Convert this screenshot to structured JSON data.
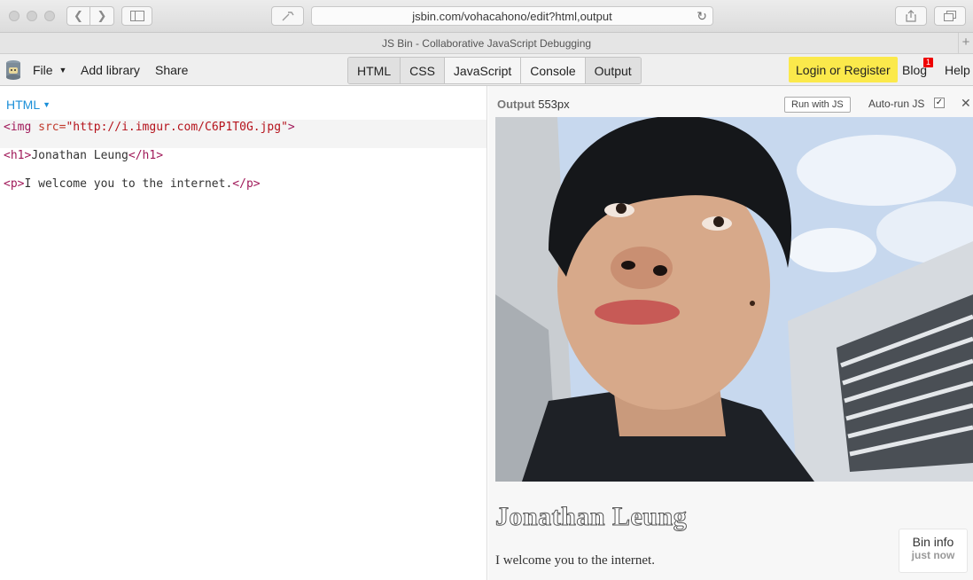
{
  "browser": {
    "url": "jsbin.com/vohacahono/edit?html,output",
    "window_title": "JS Bin - Collaborative JavaScript Debugging"
  },
  "toolbar": {
    "file_label": "File",
    "add_library_label": "Add library",
    "share_label": "Share",
    "panels": [
      "HTML",
      "CSS",
      "JavaScript",
      "Console",
      "Output"
    ],
    "login_label": "Login or Register",
    "blog_label": "Blog",
    "blog_badge": "1",
    "help_label": "Help",
    "accent_color": "#fbe94b"
  },
  "editor": {
    "language_label": "HTML",
    "lines": [
      {
        "open": "<img ",
        "attr": "src=",
        "value": "\"http://i.imgur.com/C6P1T0G.jpg\"",
        "close": ">"
      },
      {
        "open": "<h1>",
        "text": "Jonathan Leung",
        "close": "</h1>"
      },
      {
        "open": "<p>",
        "text": "I welcome you to the internet.",
        "close": "</p>"
      }
    ]
  },
  "output": {
    "title": "Output",
    "width_label": "553px",
    "run_button_label": "Run with JS",
    "autorun_label": "Auto-run JS",
    "autorun_checked": true,
    "heading": "Jonathan Leung",
    "paragraph": "I welcome you to the internet.",
    "bin_info_title": "Bin info",
    "bin_info_subtitle": "just now"
  }
}
